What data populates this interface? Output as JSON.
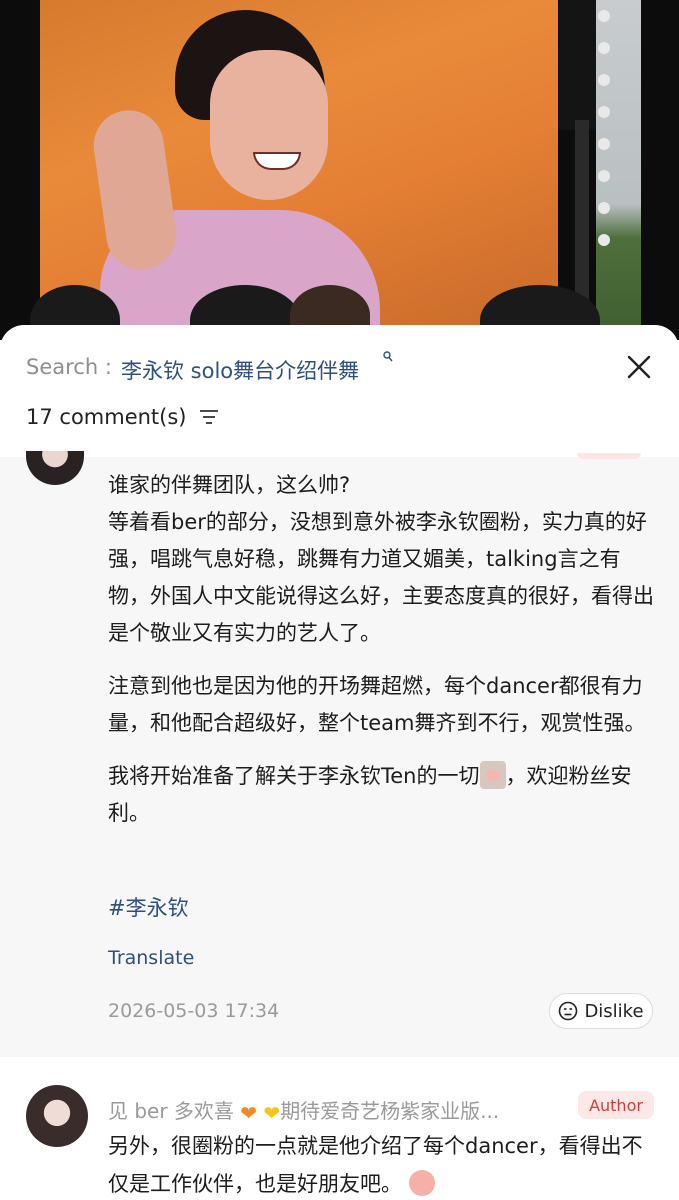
{
  "search": {
    "prefix": "Search :",
    "query": "李永钦 solo舞台介绍伴舞",
    "query_icon": "search-glyph-icon"
  },
  "comments_header": {
    "count_text": "17 comment(s)",
    "sort_icon": "sort-lines-icon"
  },
  "comment_main": {
    "paragraph_1": "谁家的伴舞团队，这么帅?\n等着看ber的部分，没想到意外被李永钦圈粉，实力真的好强，唱跳气息好稳，跳舞有力道又媚美，talking言之有物，外国人中文能说得这么好，主要态度真的很好，看得出是个敬业又有实力的艺人了。",
    "paragraph_2": "注意到他也是因为他的开场舞超燃，每个dancer都很有力量，和他配合超级好，整个team舞齐到不行，观赏性强。",
    "paragraph_3_before": "我将开始准备了解关于李永钦Ten的一切",
    "paragraph_3_after": "，欢迎粉丝安利。",
    "hashtag": "#李永钦",
    "translate_label": "Translate",
    "timestamp": "2026-05-03 17:34",
    "dislike_label": "Dislike"
  },
  "comment_reply": {
    "username_part1": "见 ber 多欢喜",
    "username_part2": "期待爱奇艺杨紫家业版...",
    "badge": "Author",
    "text_before": "另外，很圈粉的一点就是他介绍了每个dancer，看得出不仅是工作伙伴，也是好朋友吧。"
  },
  "colors": {
    "link_blue": "#2f4f7e",
    "author_red": "#d43b3b",
    "muted_gray": "#9a9a9a"
  }
}
